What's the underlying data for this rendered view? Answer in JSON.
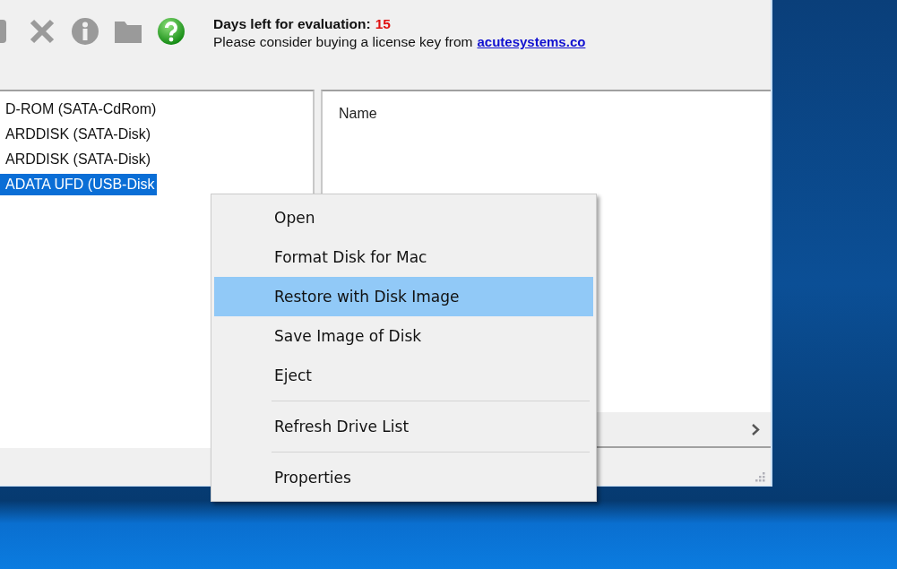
{
  "toolbar": {
    "buttons": [
      {
        "kind": "partial",
        "disabled": true
      },
      {
        "kind": "delete",
        "disabled": true
      },
      {
        "kind": "info",
        "disabled": true
      },
      {
        "kind": "folder",
        "disabled": true
      },
      {
        "kind": "help",
        "disabled": false
      }
    ]
  },
  "notice": {
    "label": "Days left for evaluation:",
    "days": "15",
    "message": "Please consider buying a license key from",
    "link": "acutesystems.co"
  },
  "drives": [
    {
      "label": "D-ROM (SATA-CdRom)",
      "selected": false
    },
    {
      "label": "ARDDISK (SATA-Disk)",
      "selected": false
    },
    {
      "label": "ARDDISK (SATA-Disk)",
      "selected": false
    },
    {
      "label": "ADATA UFD (USB-Disk",
      "selected": true
    }
  ],
  "files": {
    "columns": [
      "Name"
    ]
  },
  "context_menu": [
    {
      "kind": "item",
      "label": "Open",
      "selected": false
    },
    {
      "kind": "item",
      "label": "Format Disk for Mac",
      "selected": false
    },
    {
      "kind": "item",
      "label": "Restore with Disk Image",
      "selected": true
    },
    {
      "kind": "item",
      "label": "Save Image of Disk",
      "selected": false
    },
    {
      "kind": "item",
      "label": "Eject",
      "selected": false
    },
    {
      "kind": "separator"
    },
    {
      "kind": "item",
      "label": "Refresh Drive List",
      "selected": false
    },
    {
      "kind": "separator"
    },
    {
      "kind": "item",
      "label": "Properties",
      "selected": false
    }
  ]
}
